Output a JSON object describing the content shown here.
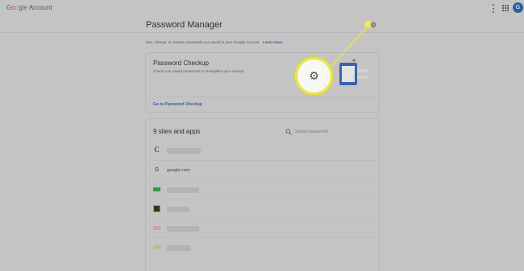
{
  "header": {
    "logo_letters": [
      "G",
      "o",
      "o",
      "g",
      "l",
      "e"
    ],
    "logo_product": "Account",
    "avatar_initial": "G"
  },
  "page": {
    "title": "Password Manager",
    "subtitle": "See, change, or remove passwords you saved in your Google Account.",
    "learn_more": "Learn more"
  },
  "checkup": {
    "title": "Password Checkup",
    "description": "Check your saved passwords to strengthen your security",
    "link": "Go to Password Checkup"
  },
  "sites": {
    "title": "9 sites and apps",
    "search_placeholder": "Search passwords",
    "rows": [
      {
        "icon": "C",
        "label": ""
      },
      {
        "icon": "G",
        "label": "google.com"
      },
      {
        "icon": "",
        "label": ""
      },
      {
        "icon": "",
        "label": ""
      },
      {
        "icon": "",
        "label": ""
      },
      {
        "icon": "",
        "label": ""
      }
    ]
  },
  "colors": {
    "accent": "#2d5ea6",
    "highlight": "#ece649",
    "overlay_background": "#c4c4c4"
  },
  "icons": {
    "settings": "gear-icon",
    "search": "search-icon",
    "more": "kebab-icon",
    "apps": "apps-grid-icon"
  }
}
